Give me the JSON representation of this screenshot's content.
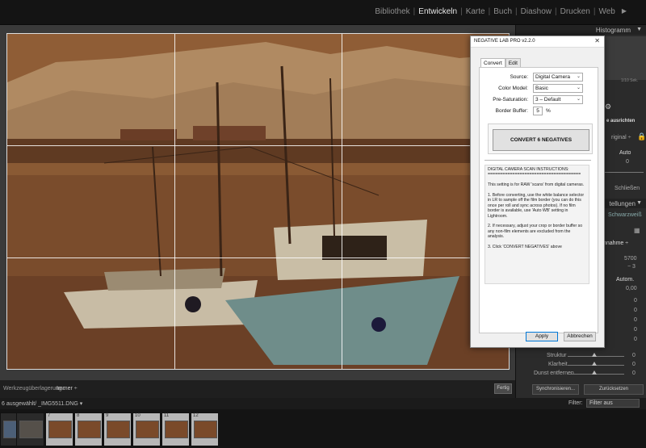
{
  "app": {
    "modules": [
      "Bibliothek",
      "Entwickeln",
      "Karte",
      "Buch",
      "Diashow",
      "Drucken",
      "Web"
    ],
    "active_module": "Entwickeln"
  },
  "right_panel": {
    "histogram_title": "Histogramm",
    "histogram_info": "1/10 Sek.",
    "auto_align": "e ausrichten",
    "original": "riginal ÷",
    "auto": "Auto",
    "close": "Schließen",
    "settings": "tellungen",
    "black_white": "Schwarzweiß",
    "wb": "hnahme ÷",
    "temp_val": "5700",
    "tint_val": "− 3",
    "autom": "Autom.",
    "zero": "0,00",
    "sliders": [
      "Struktur",
      "Klarheit",
      "Dunst entfernen"
    ],
    "slider_values": [
      "0",
      "0",
      "0"
    ],
    "sync_btn": "Synchronisieren...",
    "reset_btn": "Zurücksetzen"
  },
  "toolbar": {
    "overlay_label": "Werkzeugüberlagerung :",
    "overlay_value": "Immer ÷",
    "done": "Fertig"
  },
  "filmbar": {
    "selection": "6 ausgewählt/ _IMG5511.DNG ▾",
    "filter_label": "Filter:",
    "filter_value": "Filter aus"
  },
  "filmstrip": {
    "numbers": [
      "",
      "",
      "7",
      "8",
      "9",
      "10",
      "11",
      "12"
    ]
  },
  "dialog": {
    "title": "NEGATIVE LAB PRO v2.2.0",
    "tabs": [
      "Convert",
      "Edit"
    ],
    "source_label": "Source:",
    "source_value": "Digital Camera",
    "color_model_label": "Color Model:",
    "color_model_value": "Basic",
    "pre_saturation_label": "Pre-Saturation:",
    "pre_saturation_value": "3 – Default",
    "border_buffer_label": "Border Buffer:",
    "border_buffer_value": "5",
    "border_buffer_unit": "%",
    "convert_btn": "CONVERT 6 NEGATIVES",
    "instructions": "DIGITAL CAMERA SCAN INSTRUCTIONS:\n======================================\n\nThis setting is for RAW 'scans' from digital cameras.\n\n1. Before converting, use the white balance selector in LR to sample off the film border (you can do this once per roll and sync across photos). If no film border is available, use 'Auto WB' setting in Lightroom.\n\n2. If necessary, adjust your crop or border buffer so any non-film elements are excluded from the analysis.\n\n3. Click 'CONVERT NEGATIVES' above",
    "apply": "Apply",
    "cancel": "Abbrechen"
  }
}
